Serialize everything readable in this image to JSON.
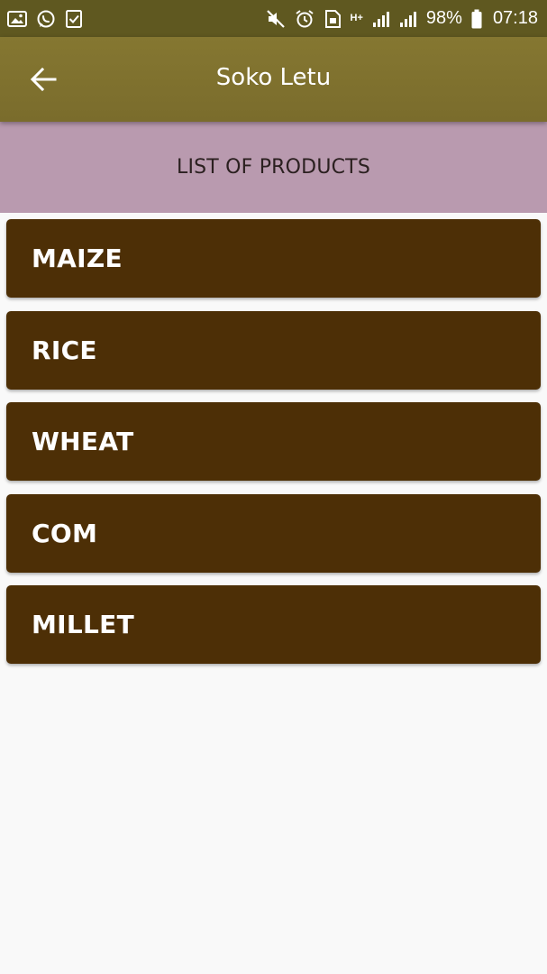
{
  "status_bar": {
    "battery_percent": "98%",
    "time": "07:18",
    "network_label": "H+",
    "left_icons": [
      "gallery-icon",
      "whatsapp-icon",
      "task-icon"
    ],
    "right_icons": [
      "mute-icon",
      "alarm-icon",
      "sim-icon",
      "signal-icon",
      "signal-icon",
      "battery-icon"
    ],
    "color": "#5f5820"
  },
  "app_bar": {
    "title": "Soko Letu",
    "back_icon": "arrow-left-icon",
    "color": "#7f712e"
  },
  "list_header": {
    "text": "LIST OF PRODUCTS",
    "color": "#b99aaf"
  },
  "products": [
    {
      "label": "MAIZE"
    },
    {
      "label": "RICE"
    },
    {
      "label": "WHEAT"
    },
    {
      "label": "COM"
    },
    {
      "label": "MILLET"
    }
  ],
  "colors": {
    "product_card": "#4d2f06",
    "background": "#f9f9f9"
  }
}
